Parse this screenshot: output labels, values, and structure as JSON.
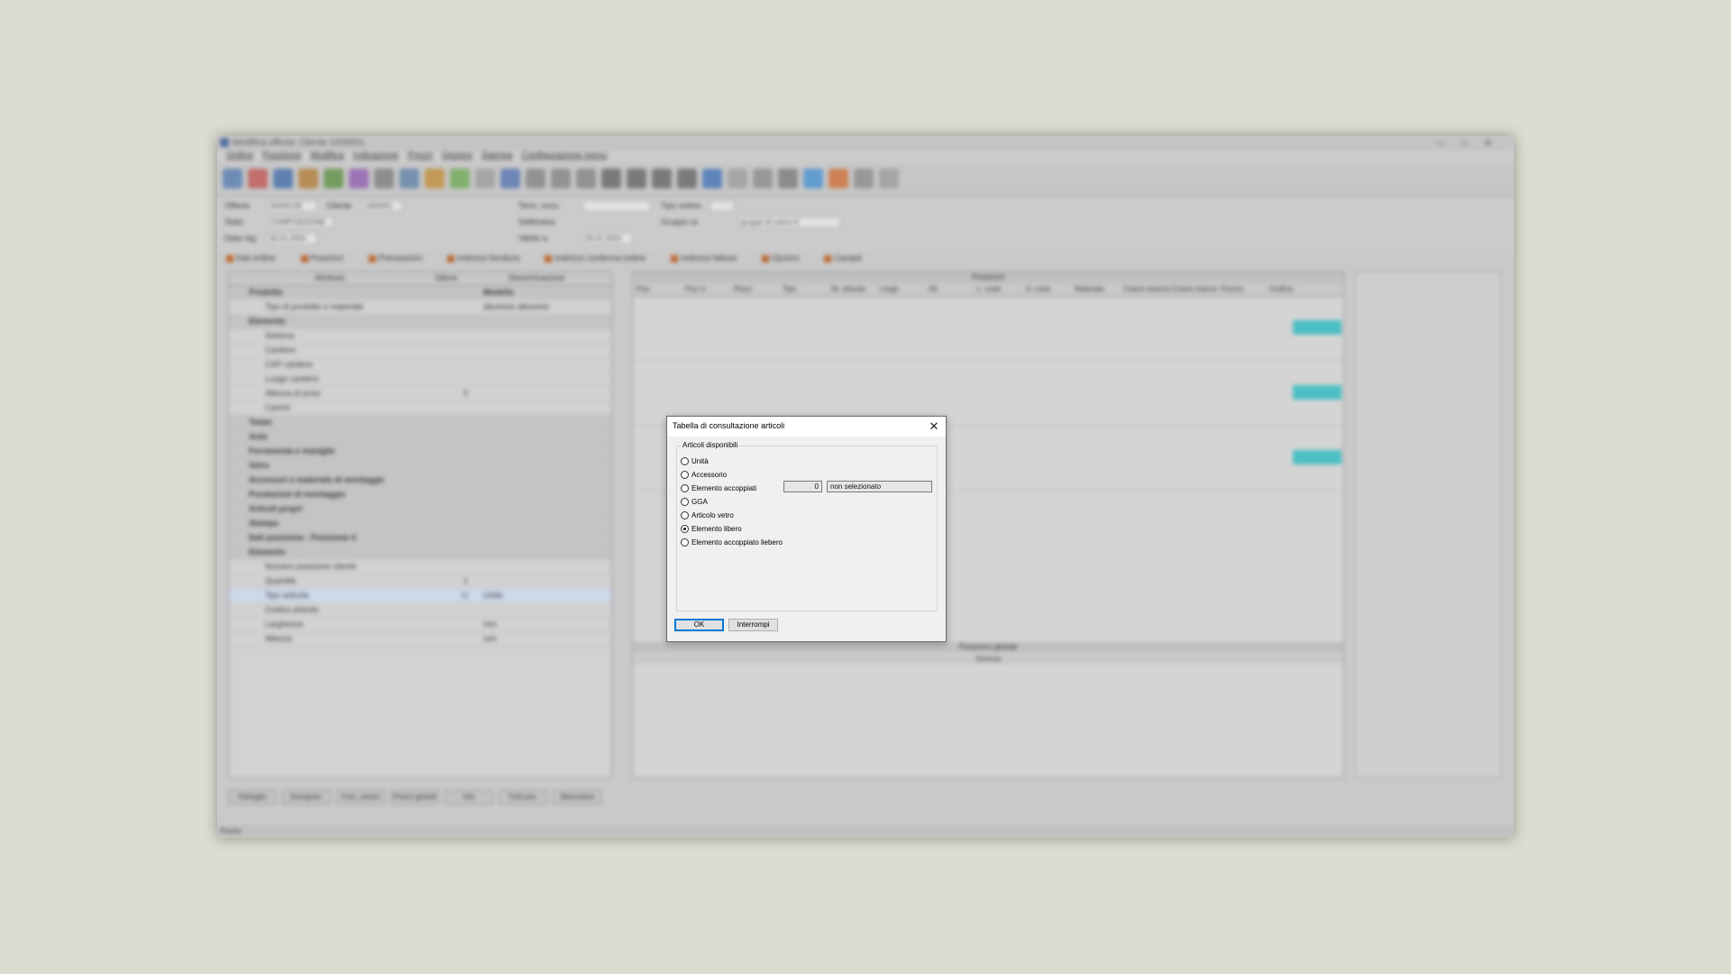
{
  "app": {
    "title": "Modifica offerta: Cliente 1000001",
    "menu": [
      "Ordine",
      "Posizione",
      "Modifica",
      "Indicazione",
      "Prezzi",
      "Opzioni",
      "Stampa",
      "Configurazione menu"
    ],
    "header": {
      "offerta_label": "Offerta",
      "offerta_value": "30000128",
      "cliente_label": "Cliente",
      "cliente_value": "1000001",
      "stato_label": "Stato",
      "stato_value": "COMPOSIZIONE",
      "data_label": "Data reg.",
      "data_value": "30.01.2024",
      "term_label": "Term. cons.",
      "tipo_ordine_label": "Tipo ordine",
      "settimana_label": "Settimana",
      "gruppo_label": "Gruppo ut.",
      "gruppo_value": "gruppo di carico A",
      "valido_label": "Valido a",
      "valido_value": "28.02.2024"
    },
    "tabs": [
      "Dati ordine",
      "Posizioni",
      "Precisazioni",
      "Indirizzo fornitura",
      "Indirizzo conferma ordine",
      "Indirizzo fattura",
      "Opzioni",
      "Campiti"
    ],
    "left_panel": {
      "columns": [
        "Attributo",
        "Valore",
        "Denominazione"
      ],
      "rows": [
        {
          "name": "Prodotto",
          "value": "",
          "desc": "Modello",
          "group": true
        },
        {
          "name": "Tipo di prodotto e materiale",
          "value": "",
          "desc": "alluminio alluminio"
        },
        {
          "name": "Elemento",
          "value": "",
          "desc": "",
          "group": true
        },
        {
          "name": "Sistema",
          "value": "",
          "desc": ""
        },
        {
          "name": "Cantiere",
          "value": "",
          "desc": ""
        },
        {
          "name": "CAP cantiere",
          "value": "",
          "desc": ""
        },
        {
          "name": "Luogo cantiere",
          "value": "",
          "desc": ""
        },
        {
          "name": "Altezza di posa",
          "value": "0",
          "desc": ""
        },
        {
          "name": "Carichi",
          "value": "",
          "desc": ""
        },
        {
          "name": "Telaio",
          "value": "",
          "desc": "",
          "group": true
        },
        {
          "name": "Anta",
          "value": "",
          "desc": "",
          "group": true
        },
        {
          "name": "Ferramenta e maniglie",
          "value": "",
          "desc": "",
          "group": true
        },
        {
          "name": "Vetro",
          "value": "",
          "desc": "",
          "group": true
        },
        {
          "name": "Accessori e materiale di montaggio",
          "value": "",
          "desc": "",
          "group": true
        },
        {
          "name": "Prestazioni di montaggio",
          "value": "",
          "desc": "",
          "group": true
        },
        {
          "name": "Articoli propri",
          "value": "",
          "desc": "",
          "group": true
        },
        {
          "name": "Stampa",
          "value": "",
          "desc": "",
          "group": true
        },
        {
          "name": "Dati posizione - Posizione 4",
          "value": "",
          "desc": "",
          "group": true
        },
        {
          "name": "Elemento",
          "value": "",
          "desc": "",
          "group": true
        },
        {
          "name": "Numero posizione cliente",
          "value": "",
          "desc": ""
        },
        {
          "name": "Quantità",
          "value": "1",
          "desc": ""
        },
        {
          "name": "Tipo articolo",
          "value": "U",
          "desc": "Unità",
          "selected": true
        },
        {
          "name": "Codice articolo",
          "value": "",
          "desc": ""
        },
        {
          "name": "Larghezza",
          "value": "",
          "desc": "mm"
        },
        {
          "name": "Altezza",
          "value": "",
          "desc": "mm"
        }
      ]
    },
    "right_panel": {
      "title": "Posizioni",
      "columns": [
        "Pos.",
        "Pos cl.",
        "Pezzi",
        "Tipo",
        "Nr. articolo",
        "Largh.",
        "Alt.",
        "L. costr.",
        "A. costr.",
        "Materiale",
        "Colore esterno",
        "Colore interno",
        "Prezzo",
        "Grafica"
      ],
      "summary_title": "Posizioni globali",
      "summary_col": "Somma"
    },
    "bottom_buttons": [
      "Dettaglio",
      "Assegnaz.",
      "Cerc. prezzi",
      "Prezzi globali",
      "Info",
      "Tutti pos.",
      "Alternativa"
    ],
    "status": "Pronto"
  },
  "dialog": {
    "title": "Tabella di consultazione articoli",
    "group_label": "Articoli disponibili",
    "options": [
      {
        "label": "Unità",
        "checked": false
      },
      {
        "label": "Accessorio",
        "checked": false
      },
      {
        "label": "Elemento accoppiati",
        "checked": false
      },
      {
        "label": "GGA",
        "checked": false
      },
      {
        "label": "Articolo vetro",
        "checked": false
      },
      {
        "label": "Elemento libero",
        "checked": true
      },
      {
        "label": "Elemento accoppiato liebero",
        "checked": false
      }
    ],
    "quantity_value": "0",
    "selection_value": "non selezionato",
    "ok_label": "OK",
    "cancel_label": "Interrompi"
  }
}
